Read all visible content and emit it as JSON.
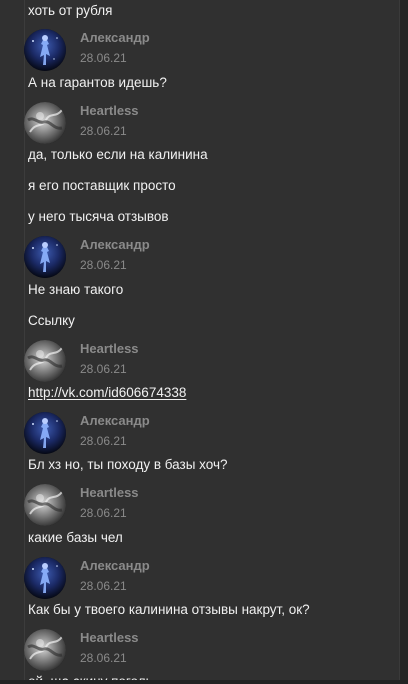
{
  "chat": {
    "messages": [
      {
        "kind": "text",
        "text": "хоть от рубля"
      },
      {
        "kind": "header",
        "author": "Александр",
        "date": "28.06.21",
        "avatar": "cosmic-figure-avatar"
      },
      {
        "kind": "text",
        "text": "А на гарантов идешь?"
      },
      {
        "kind": "header",
        "author": "Heartless",
        "date": "28.06.21",
        "avatar": "grey-smoke-avatar"
      },
      {
        "kind": "text",
        "text": "да, только если на калинина"
      },
      {
        "kind": "text",
        "text": "я его поставщик просто"
      },
      {
        "kind": "text",
        "text": "у него тысяча отзывов"
      },
      {
        "kind": "header",
        "author": "Александр",
        "date": "28.06.21",
        "avatar": "cosmic-figure-avatar"
      },
      {
        "kind": "text",
        "text": "Не знаю такого"
      },
      {
        "kind": "text",
        "text": "Ссылку"
      },
      {
        "kind": "header",
        "author": "Heartless",
        "date": "28.06.21",
        "avatar": "grey-smoke-avatar"
      },
      {
        "kind": "link",
        "text": "http://vk.com/id606674338"
      },
      {
        "kind": "header",
        "author": "Александр",
        "date": "28.06.21",
        "avatar": "cosmic-figure-avatar"
      },
      {
        "kind": "text",
        "text": "Бл хз но, ты походу в базы хоч?"
      },
      {
        "kind": "header",
        "author": "Heartless",
        "date": "28.06.21",
        "avatar": "grey-smoke-avatar"
      },
      {
        "kind": "text",
        "text": "какие базы чел"
      },
      {
        "kind": "header",
        "author": "Александр",
        "date": "28.06.21",
        "avatar": "cosmic-figure-avatar"
      },
      {
        "kind": "text",
        "text": "Как бы у твоего калинина отзывы накрут, ок?"
      },
      {
        "kind": "header",
        "author": "Heartless",
        "date": "28.06.21",
        "avatar": "grey-smoke-avatar"
      },
      {
        "kind": "text",
        "text": "ой, ща скину поголь"
      }
    ]
  },
  "colors": {
    "background": "#303030",
    "text": "#f1f1f1",
    "meta": "#8a8a8a"
  }
}
